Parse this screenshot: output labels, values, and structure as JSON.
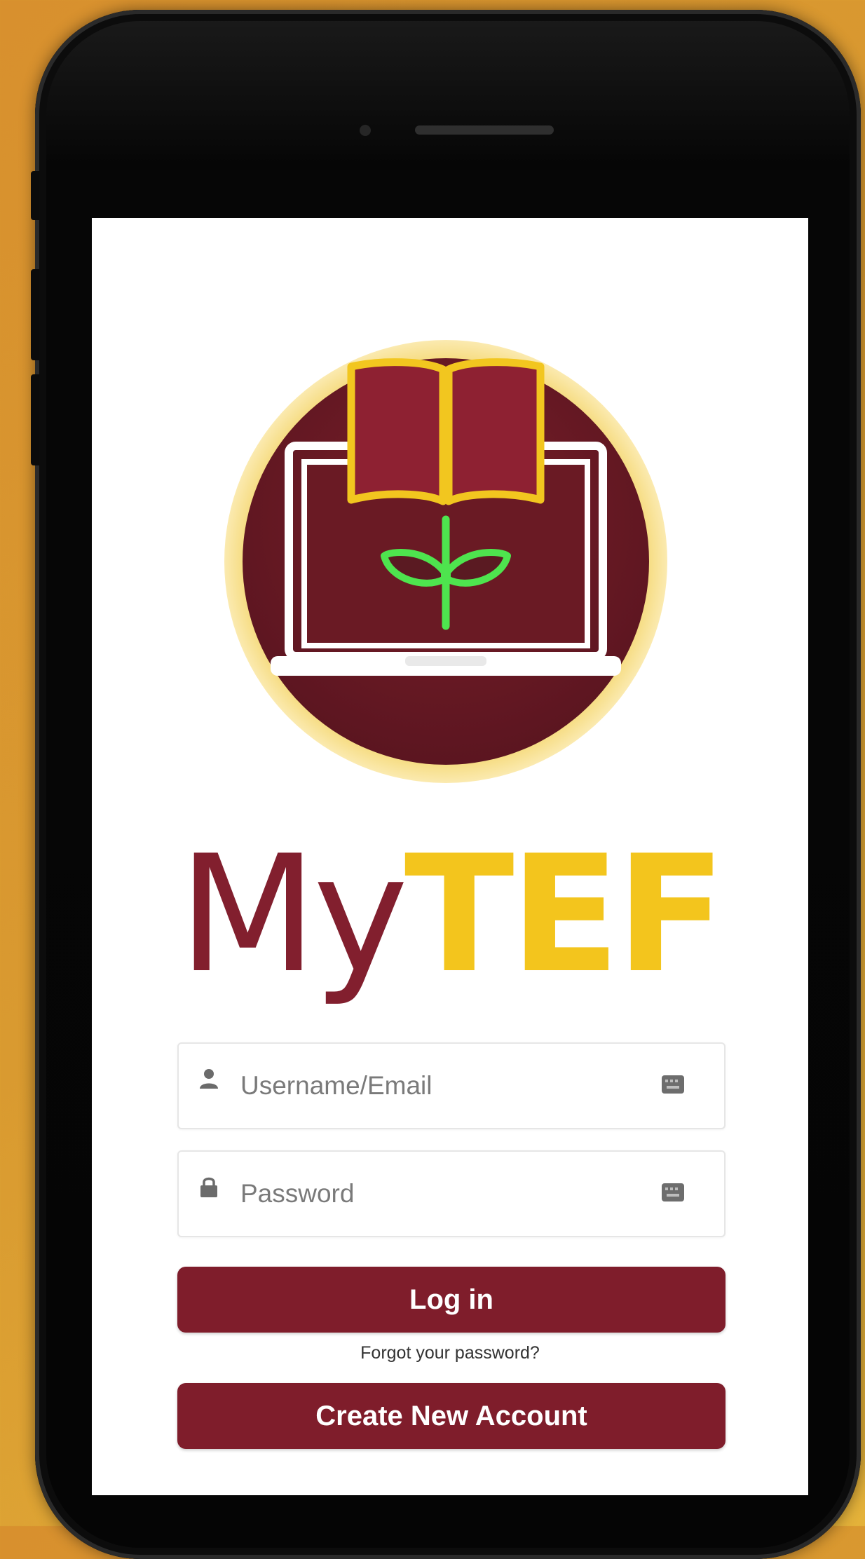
{
  "app": {
    "brand_my": "My",
    "brand_tef": "TEF"
  },
  "login": {
    "username_placeholder": "Username/Email",
    "password_placeholder": "Password",
    "login_label": "Log in",
    "forgot_label": "Forgot your password?",
    "create_label": "Create New Account"
  },
  "icons": {
    "username": "user-icon",
    "password": "lock-icon",
    "autofill": "keyboard-icon"
  },
  "colors": {
    "background": "#d8902e",
    "brand_primary": "#7f1d2b",
    "brand_accent": "#f3c51d",
    "logo_ring": "#f0cf5f",
    "sprout": "#4ee44e"
  }
}
